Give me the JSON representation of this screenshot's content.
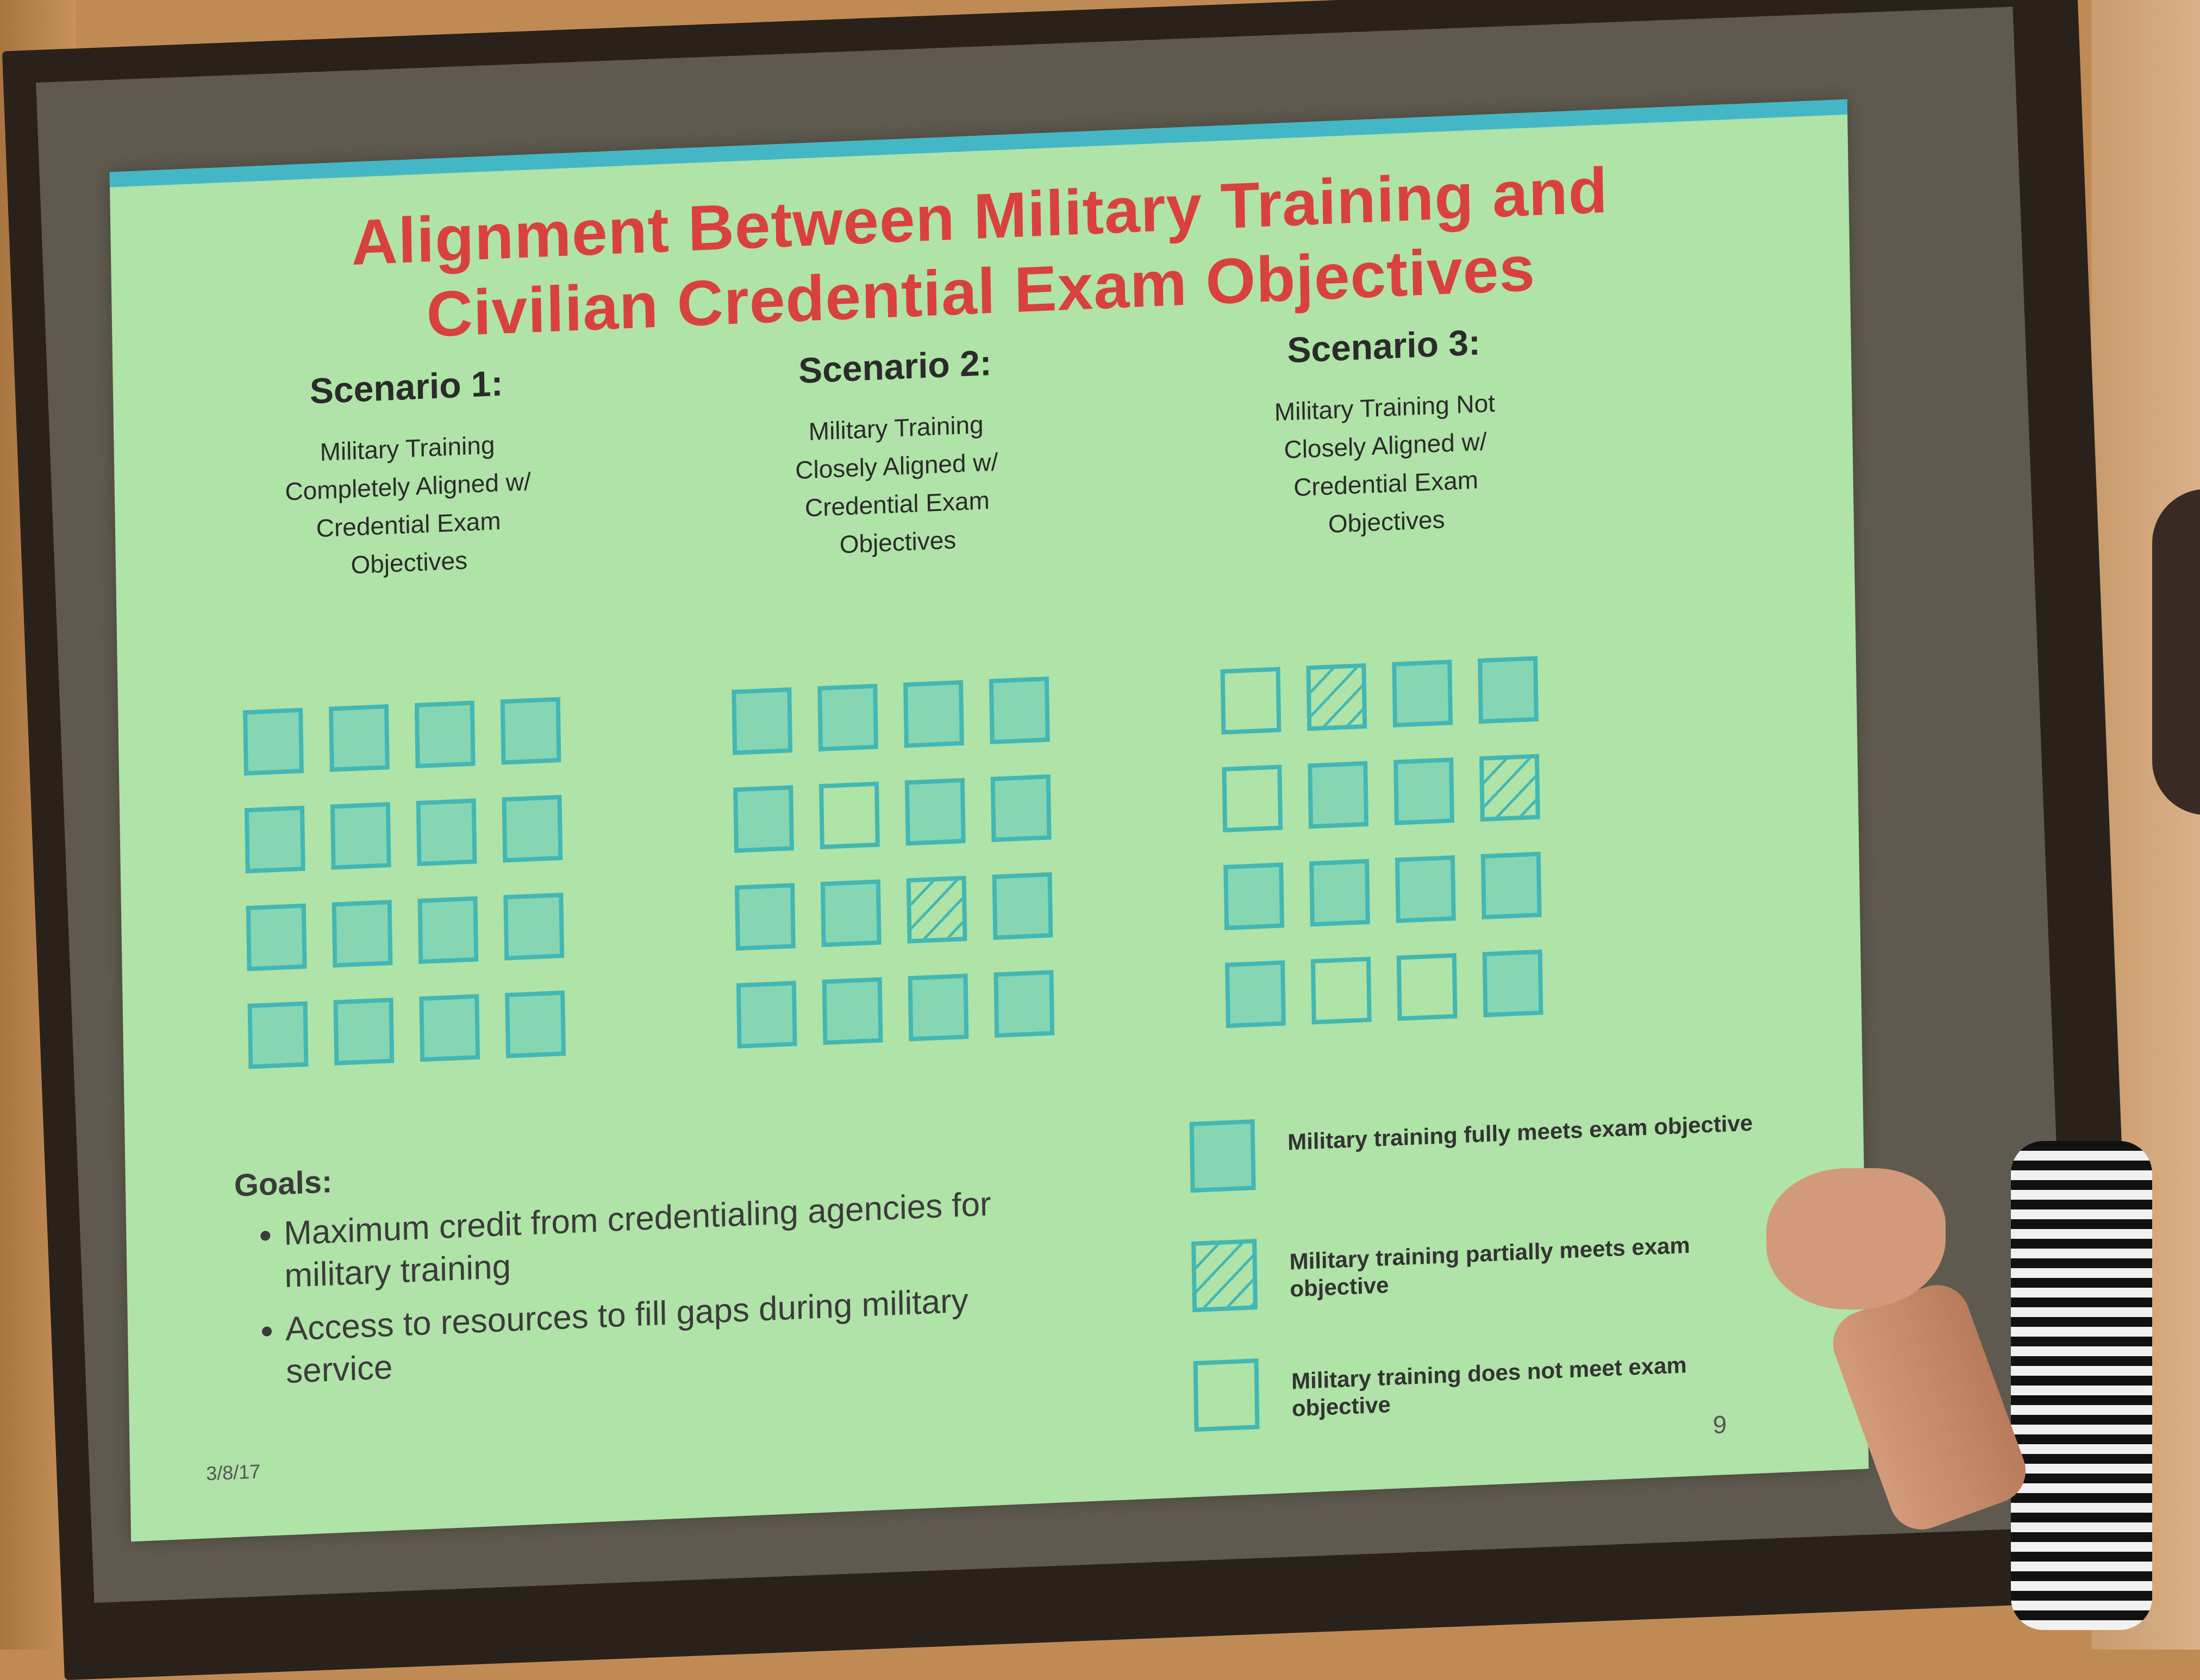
{
  "slide": {
    "title_line1": "Alignment Between Military Training and",
    "title_line2": "Civilian Credential Exam Objectives",
    "date": "3/8/17",
    "page_number": "9",
    "colors": {
      "title": "#d9413f",
      "background": "#b0e3a7",
      "accent_band": "#44b7c6",
      "cell_border": "#43b7b4",
      "cell_fill": "#86d6b4"
    }
  },
  "scenarios": [
    {
      "name": "Scenario 1:",
      "description_lines": [
        "Military Training",
        "Completely Aligned w/",
        "Credential Exam",
        "Objectives"
      ],
      "grid": [
        [
          "full",
          "full",
          "full",
          "full"
        ],
        [
          "full",
          "full",
          "full",
          "full"
        ],
        [
          "full",
          "full",
          "full",
          "full"
        ],
        [
          "full",
          "full",
          "full",
          "full"
        ]
      ]
    },
    {
      "name": "Scenario 2:",
      "description_lines": [
        "Military Training",
        "Closely Aligned w/",
        "Credential Exam",
        "Objectives"
      ],
      "grid": [
        [
          "full",
          "full",
          "full",
          "full"
        ],
        [
          "full",
          "empty",
          "full",
          "full"
        ],
        [
          "full",
          "full",
          "partial",
          "full"
        ],
        [
          "full",
          "full",
          "full",
          "full"
        ]
      ]
    },
    {
      "name": "Scenario 3:",
      "description_lines": [
        "Military Training Not",
        "Closely Aligned w/",
        "Credential Exam",
        "Objectives"
      ],
      "grid": [
        [
          "empty",
          "partial",
          "full",
          "full"
        ],
        [
          "empty",
          "full",
          "full",
          "partial"
        ],
        [
          "full",
          "full",
          "full",
          "full"
        ],
        [
          "full",
          "empty",
          "empty",
          "full"
        ]
      ]
    }
  ],
  "goals": {
    "heading": "Goals:",
    "items": [
      "Maximum credit from credentialing agencies for military training",
      "Access to resources to fill gaps during military service"
    ]
  },
  "legend": [
    {
      "state": "full",
      "label": "Military training fully meets exam objective"
    },
    {
      "state": "partial",
      "label": "Military training partially meets exam objective"
    },
    {
      "state": "empty",
      "label": "Military training does not meet exam objective"
    }
  ]
}
